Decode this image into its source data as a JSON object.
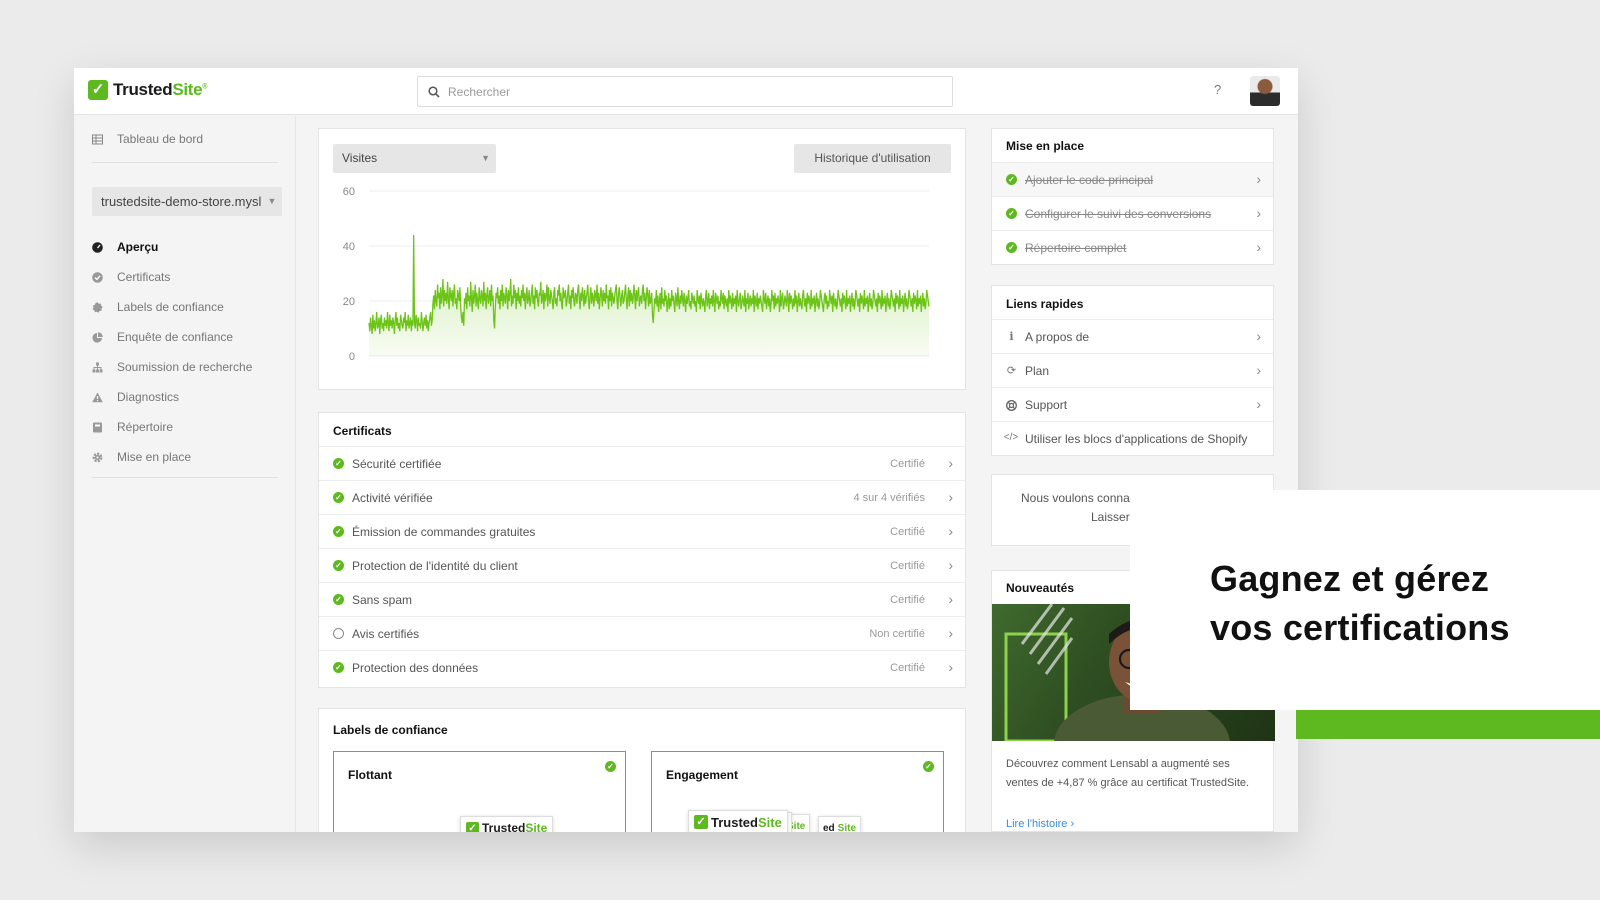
{
  "brand": {
    "name_part1": "Trusted",
    "name_part2": "Site",
    "trademark": "®",
    "accent": "#5db91f"
  },
  "topbar": {
    "search_placeholder": "Rechercher",
    "help_label": "?"
  },
  "sidebar": {
    "dashboard_label": "Tableau de bord",
    "store_select": "trustedsite-demo-store.mysl",
    "items": [
      {
        "label": "Aperçu",
        "icon": "dashboard-gauge-icon",
        "active": true
      },
      {
        "label": "Certificats",
        "icon": "check-circle-icon",
        "active": false
      },
      {
        "label": "Labels de confiance",
        "icon": "badge-seal-icon",
        "active": false
      },
      {
        "label": "Enquête de confiance",
        "icon": "pie-chart-icon",
        "active": false
      },
      {
        "label": "Soumission de recherche",
        "icon": "sitemap-icon",
        "active": false
      },
      {
        "label": "Diagnostics",
        "icon": "warning-triangle-icon",
        "active": false
      },
      {
        "label": "Répertoire",
        "icon": "book-icon",
        "active": false
      },
      {
        "label": "Mise en place",
        "icon": "gear-icon",
        "active": false
      }
    ]
  },
  "chart": {
    "metric_select": "Visites",
    "history_button": "Historique d'utilisation"
  },
  "chart_data": {
    "type": "area",
    "title": "",
    "xlabel": "",
    "ylabel": "",
    "ylim": [
      0,
      60
    ],
    "yticks": [
      "60",
      "40",
      "20",
      "0"
    ],
    "grid": true,
    "color": "#6cc417",
    "series": [
      {
        "values": [
          12,
          9,
          14,
          11,
          8,
          15,
          10,
          13,
          9,
          12,
          16,
          10,
          11,
          14,
          8,
          13,
          15,
          10,
          12,
          9,
          14,
          11,
          13,
          10,
          16,
          12,
          9,
          15,
          11,
          13,
          10,
          14,
          12,
          8,
          13,
          16,
          11,
          14,
          10,
          12,
          9,
          15,
          13,
          11,
          10,
          14,
          12,
          16,
          9,
          13,
          11,
          15,
          10,
          12,
          14,
          9,
          13,
          11,
          44,
          12,
          10,
          15,
          13,
          9,
          14,
          11,
          12,
          10,
          16,
          13,
          9,
          12,
          14,
          11,
          15,
          10,
          13,
          9,
          12,
          14,
          16,
          11,
          13,
          19,
          22,
          17,
          24,
          20,
          18,
          26,
          21,
          23,
          17,
          25,
          19,
          22,
          28,
          18,
          24,
          20,
          23,
          19,
          27,
          21,
          17,
          25,
          22,
          20,
          24,
          18,
          23,
          26,
          19,
          21,
          17,
          24,
          22,
          20,
          25,
          18,
          14,
          12,
          16,
          11,
          21,
          19,
          23,
          17,
          25,
          20,
          22,
          18,
          27,
          21,
          16,
          24,
          19,
          22,
          26,
          18,
          23,
          20,
          17,
          25,
          21,
          19,
          24,
          22,
          18,
          27,
          20,
          23,
          17,
          22,
          25,
          19,
          21,
          24,
          18,
          26,
          20,
          22,
          13,
          10,
          18,
          23,
          21,
          25,
          19,
          22,
          17,
          24,
          20,
          26,
          18,
          23,
          21,
          19,
          25,
          22,
          17,
          24,
          20,
          23,
          28,
          18,
          22,
          19,
          26,
          21,
          24,
          17,
          23,
          20,
          25,
          19,
          22,
          18,
          24,
          21,
          26,
          20,
          23,
          17,
          22,
          25,
          19,
          21,
          24,
          18,
          20,
          23,
          26,
          19,
          22,
          17,
          25,
          21,
          24,
          20,
          18,
          23,
          22,
          27,
          19,
          21,
          24,
          17,
          23,
          20,
          22,
          26,
          18,
          25,
          21,
          19,
          24,
          22,
          20,
          17,
          23,
          25,
          19,
          21,
          18,
          24,
          22,
          26,
          20,
          23,
          19,
          17,
          25,
          21,
          22,
          24,
          18,
          20,
          23,
          26,
          19,
          22,
          17,
          24,
          21,
          25,
          20,
          18,
          23,
          22,
          19,
          24,
          26,
          21,
          17,
          23,
          20,
          25,
          22,
          18,
          24,
          19,
          21,
          23,
          26,
          20,
          17,
          22,
          25,
          19,
          23,
          21,
          18,
          24,
          22,
          20,
          26,
          19,
          23,
          17,
          21,
          25,
          22,
          18,
          24,
          20,
          23,
          19,
          26,
          21,
          22,
          17,
          24,
          20,
          25,
          18,
          23,
          21,
          19,
          22,
          24,
          26,
          20,
          17,
          23,
          25,
          21,
          18,
          22,
          24,
          19,
          20,
          23,
          26,
          21,
          17,
          22,
          25,
          18,
          24,
          20,
          23,
          19,
          21,
          26,
          22,
          17,
          24,
          20,
          23,
          25,
          18,
          21,
          22,
          19,
          24,
          26,
          20,
          23,
          17,
          21,
          25,
          22,
          18,
          24,
          19,
          20,
          23,
          15,
          12,
          17,
          21,
          19,
          24,
          18,
          22,
          16,
          20,
          23,
          17,
          25,
          19,
          21,
          18,
          24,
          20,
          22,
          16,
          19,
          23,
          17,
          21,
          18,
          24,
          20,
          22,
          19,
          16,
          23,
          21,
          18,
          25,
          20,
          17,
          22,
          19,
          24,
          21,
          18,
          23,
          20,
          16,
          22,
          19,
          21,
          24,
          18,
          20,
          17,
          23,
          21,
          19,
          22,
          18,
          20,
          16,
          24,
          21,
          19,
          22,
          17,
          23,
          20,
          18,
          21,
          19,
          16,
          22,
          24,
          18,
          20,
          23,
          17,
          21,
          19,
          22,
          18,
          24,
          20,
          16,
          23,
          21,
          19,
          22,
          17,
          20,
          18,
          24,
          21,
          19,
          23,
          17,
          22,
          20,
          18,
          21,
          16,
          24,
          19,
          22,
          20,
          17,
          23,
          18,
          21,
          19,
          22,
          16,
          24,
          20,
          18,
          21,
          23,
          17,
          19,
          22,
          20,
          18,
          24,
          16,
          21,
          19,
          23,
          17,
          20,
          22,
          18,
          21,
          19,
          24,
          16,
          22,
          20,
          18,
          23,
          17,
          21,
          19,
          22,
          20,
          18,
          16,
          24,
          21,
          19,
          23,
          17,
          20,
          22,
          18,
          21,
          16,
          19,
          24,
          20,
          22,
          17,
          23,
          18,
          21,
          19,
          22,
          20,
          16,
          24,
          18,
          21,
          23,
          17,
          19,
          22,
          20,
          18,
          24,
          21,
          16,
          23,
          19,
          22,
          20,
          17,
          21,
          18,
          24,
          19,
          22,
          16,
          20,
          23,
          18,
          21,
          19,
          17,
          22,
          24,
          20,
          18,
          21,
          16,
          23,
          19,
          22,
          20,
          17,
          24,
          18,
          21,
          19,
          22,
          16,
          20,
          23,
          18,
          21,
          17,
          19,
          24,
          22,
          20,
          18,
          16,
          21,
          23,
          19,
          22,
          17,
          20,
          18,
          24,
          21,
          19,
          22,
          16,
          23,
          20,
          18,
          21,
          17,
          19,
          24,
          22,
          20,
          18,
          21,
          16,
          23,
          19,
          22,
          20,
          17,
          24,
          18,
          21,
          19,
          22,
          16,
          20,
          23,
          18,
          21,
          17,
          19,
          24,
          22,
          20,
          18,
          21,
          16,
          23,
          19,
          22,
          20,
          17,
          24,
          18,
          21,
          19,
          22,
          16,
          20,
          23,
          18,
          21,
          17,
          19,
          24,
          22,
          20,
          18,
          21,
          16,
          23,
          19,
          22,
          20,
          17,
          24,
          18,
          21,
          19,
          22,
          16,
          20,
          23,
          18,
          21,
          17,
          19,
          24,
          22,
          20,
          18,
          21,
          16,
          23,
          19,
          22,
          20,
          17,
          24,
          18,
          21,
          19,
          22,
          16,
          20,
          23,
          18,
          21,
          17,
          19,
          24,
          22,
          20,
          18,
          21,
          16,
          23,
          19,
          22,
          20,
          17,
          24,
          18,
          21,
          19,
          22,
          16,
          20,
          23,
          18,
          21,
          17,
          19,
          24,
          22,
          20,
          18
        ]
      }
    ]
  },
  "certificates": {
    "title": "Certificats",
    "rows": [
      {
        "label": "Sécurité certifiée",
        "status": "Certifié",
        "certified": true
      },
      {
        "label": "Activité vérifiée",
        "status": "4 sur 4 vérifiés",
        "certified": true
      },
      {
        "label": "Émission de commandes gratuites",
        "status": "Certifié",
        "certified": true
      },
      {
        "label": "Protection de l'identité du client",
        "status": "Certifié",
        "certified": true
      },
      {
        "label": "Sans spam",
        "status": "Certifié",
        "certified": true
      },
      {
        "label": "Avis certifiés",
        "status": "Non certifié",
        "certified": false
      },
      {
        "label": "Protection des données",
        "status": "Certifié",
        "certified": true
      }
    ]
  },
  "trust_labels": {
    "title": "Labels de confiance",
    "boxes": [
      {
        "label": "Flottant"
      },
      {
        "label": "Engagement"
      }
    ],
    "badge_part1": "Trusted",
    "badge_part2": "Site",
    "badge_partial_1": "ed",
    "badge_partial_2": "ted",
    "badge_partial_3": "ed"
  },
  "setup": {
    "title": "Mise en place",
    "items": [
      {
        "label": "Ajouter le code principal",
        "done": true
      },
      {
        "label": "Configurer le suivi des conversions",
        "done": true
      },
      {
        "label": "Répertoire complet",
        "done": true
      }
    ]
  },
  "quick_links": {
    "title": "Liens rapides",
    "items": [
      {
        "label": "A propos de",
        "icon": "info-icon"
      },
      {
        "label": "Plan",
        "icon": "refresh-icon"
      },
      {
        "label": "Support",
        "icon": "lifebuoy-icon"
      },
      {
        "label": "Utiliser les blocs d'applications de Shopify",
        "icon": "code-icon"
      }
    ]
  },
  "feedback": {
    "text": "Nous voulons conna",
    "link": "Laisser"
  },
  "news": {
    "title": "Nouveautés",
    "text": "Découvrez comment Lensabl a augmenté ses ventes de +4,87 % grâce au certificat TrustedSite.",
    "link": "Lire l'histoire ›"
  },
  "promo": {
    "line1": "Gagnez et gérez",
    "line2": "vos certifications"
  }
}
